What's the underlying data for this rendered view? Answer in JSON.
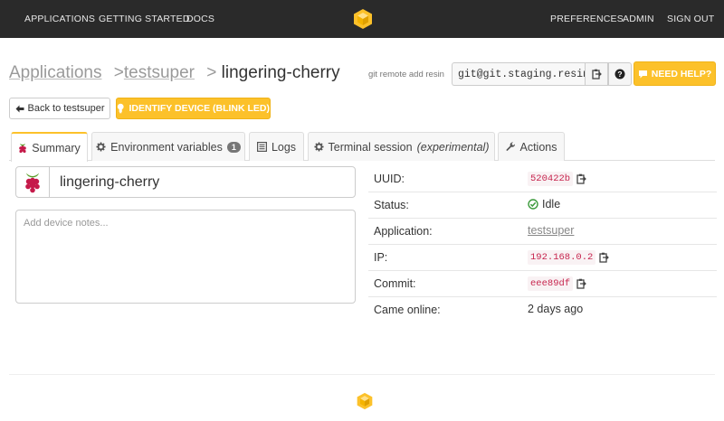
{
  "nav": {
    "left": [
      "APPLICATIONS",
      "GETTING STARTED",
      "DOCS"
    ],
    "right": [
      "PREFERENCES",
      "ADMIN",
      "SIGN OUT"
    ],
    "logo_icon": "cube-logo-icon"
  },
  "breadcrumb": {
    "applications": "Applications",
    "app": "testsuper",
    "sep": ">",
    "device": "lingering-cherry"
  },
  "git": {
    "label": "git remote add resin",
    "value": "git@git.staging.resin.io:testsuper/testsuper.git",
    "copy_icon": "clipboard-icon",
    "help_icon": "question-icon"
  },
  "help_button": {
    "label": "NEED HELP?",
    "icon": "chat-icon"
  },
  "actions": {
    "back_label": "Back to testsuper",
    "back_icon": "arrow-left-icon",
    "identify_label": "IDENTIFY DEVICE (BLINK LED)",
    "identify_icon": "lightbulb-icon"
  },
  "tabs": [
    {
      "label": "Summary",
      "icon": "raspberry-icon"
    },
    {
      "label": "Environment variables",
      "badge": "1",
      "icon": "gear-icon"
    },
    {
      "label": "Logs",
      "icon": "list-icon"
    },
    {
      "label": "Terminal session",
      "suffix": "(experimental)",
      "icon": "gear-icon"
    },
    {
      "label": "Actions",
      "icon": "wrench-icon"
    }
  ],
  "summary": {
    "device_name": "lingering-cherry",
    "device_icon": "raspberry-pi-icon",
    "notes_placeholder": "Add device notes..."
  },
  "info": {
    "uuid_label": "UUID:",
    "uuid_value": "520422b",
    "status_label": "Status:",
    "status_value": "Idle",
    "application_label": "Application:",
    "application_value": "testsuper",
    "ip_label": "IP:",
    "ip_value": "192.168.0.2",
    "commit_label": "Commit:",
    "commit_value": "eee89df",
    "online_label": "Came online:",
    "online_value": "2 days ago"
  },
  "colors": {
    "accent": "#fcc12a",
    "nav_bg": "#2a2a2a",
    "code": "#c7254e",
    "status_ok": "#3c9a3c"
  }
}
